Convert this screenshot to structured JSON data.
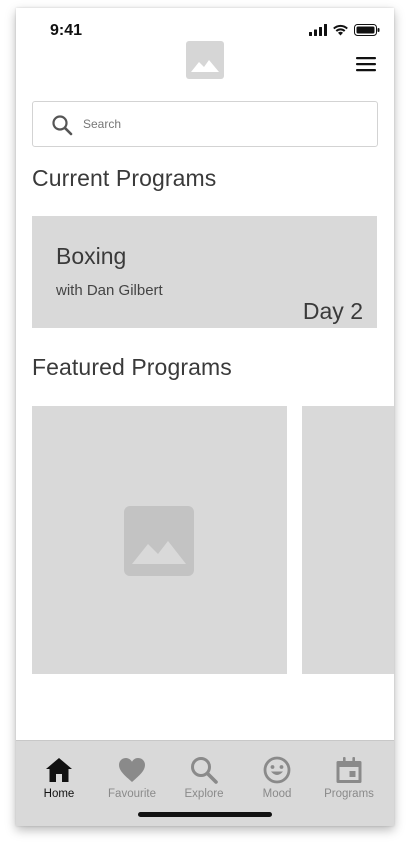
{
  "status_bar": {
    "time": "9:41"
  },
  "header": {
    "logo_icon": "image-placeholder-icon",
    "menu_icon": "hamburger-menu-icon"
  },
  "search": {
    "placeholder": "Search",
    "value": ""
  },
  "current_programs": {
    "title": "Current Programs",
    "card": {
      "name": "Boxing",
      "instructor": "with Dan Gilbert",
      "progress": "Day 2"
    }
  },
  "featured_programs": {
    "title": "Featured Programs",
    "cards": [
      {
        "image_icon": "image-placeholder-icon"
      },
      {
        "image_icon": "image-placeholder-icon"
      }
    ]
  },
  "tab_bar": {
    "active": "Home",
    "items": [
      {
        "label": "Home",
        "icon": "home-icon"
      },
      {
        "label": "Favourite",
        "icon": "heart-icon"
      },
      {
        "label": "Explore",
        "icon": "search-icon"
      },
      {
        "label": "Mood",
        "icon": "smiley-icon"
      },
      {
        "label": "Programs",
        "icon": "calendar-icon"
      }
    ]
  },
  "colors": {
    "placeholder_gray": "#d9d9d9",
    "active_tab": "#111111",
    "inactive_tab": "#8a8a8a",
    "heading_text": "#3a3a3a"
  }
}
